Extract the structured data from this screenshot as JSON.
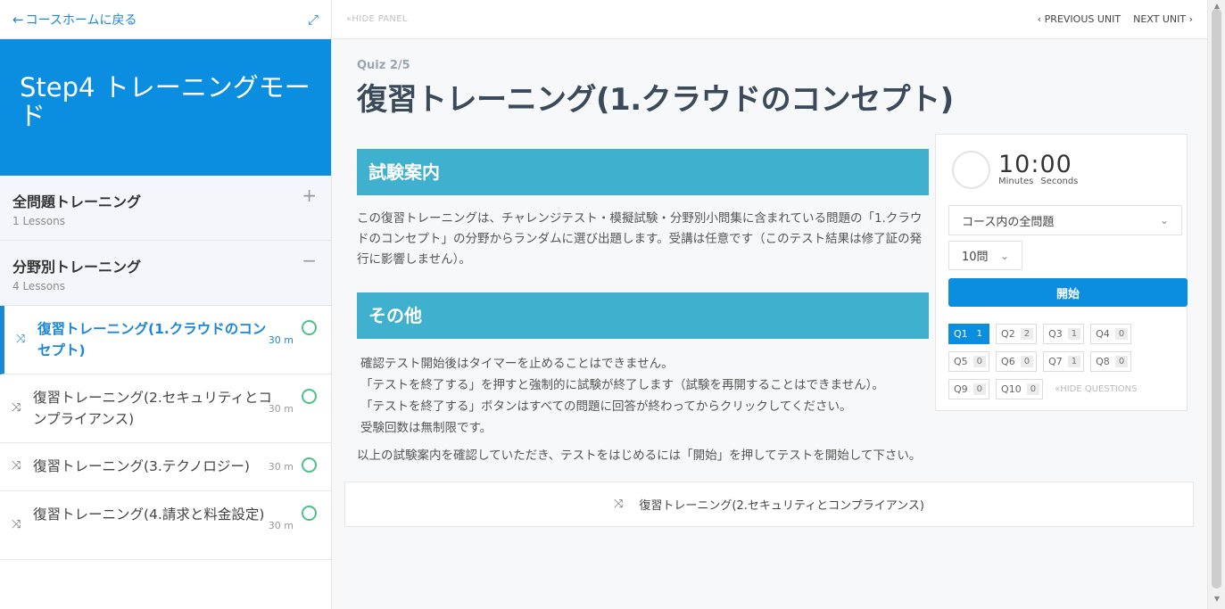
{
  "sidebar": {
    "back_label": "コースホームに戻る",
    "course_title": "Step4 トレーニングモード",
    "sections": [
      {
        "title": "全問題トレーニング",
        "sub": "1 Lessons",
        "toggle": "+"
      },
      {
        "title": "分野別トレーニング",
        "sub": "4 Lessons",
        "toggle": "−"
      }
    ],
    "lessons": [
      {
        "title": "復習トレーニング(1.クラウドのコンセプト)",
        "duration": "30 m"
      },
      {
        "title": "復習トレーニング(2.セキュリティとコンプライアンス)",
        "duration": "30 m"
      },
      {
        "title": "復習トレーニング(3.テクノロジー)",
        "duration": "30 m"
      },
      {
        "title": "復習トレーニング(4.請求と料金設定)",
        "duration": "30 m"
      }
    ]
  },
  "topbar": {
    "hide_panel": "HIDE PANEL",
    "prev_unit": "PREVIOUS UNIT",
    "next_unit": "NEXT UNIT"
  },
  "main": {
    "quiz_label": "Quiz 2/5",
    "title": "復習トレーニング(1.クラウドのコンセプト)",
    "section1_title": "試験案内",
    "section1_text": "この復習トレーニングは、チャレンジテスト・模擬試験・分野別小問集に含まれている問題の「1.クラウドのコンセプト」の分野からランダムに選び出題します。受講は任意です（このテスト結果は修了証の発行に影響しません）。",
    "section2_title": "その他",
    "section2_lines": [
      "確認テスト開始後はタイマーを止めることはできません。",
      "「テストを終了する」を押すと強制的に試験が終了します（試験を再開することはできません）。",
      "「テストを終了する」ボタンはすべての問題に回答が終わってからクリックしてください。",
      "受験回数は無制限です。"
    ],
    "closing_text": "以上の試験案内を確認していただき、テストをはじめるには「開始」を押してテストを開始して下さい。",
    "next_lesson": "復習トレーニング(2.セキュリティとコンプライアンス)"
  },
  "timer": {
    "minutes": "10",
    "seconds": "00",
    "minutes_label": "Minutes",
    "seconds_label": "Seconds",
    "scope_select": "コース内の全問題",
    "count_select": "10問",
    "start_label": "開始",
    "hide_questions": "HIDE QUESTIONS",
    "questions": [
      {
        "label": "Q1",
        "count": "1"
      },
      {
        "label": "Q2",
        "count": "2"
      },
      {
        "label": "Q3",
        "count": "1"
      },
      {
        "label": "Q4",
        "count": "0"
      },
      {
        "label": "Q5",
        "count": "0"
      },
      {
        "label": "Q6",
        "count": "0"
      },
      {
        "label": "Q7",
        "count": "1"
      },
      {
        "label": "Q8",
        "count": "0"
      },
      {
        "label": "Q9",
        "count": "0"
      },
      {
        "label": "Q10",
        "count": "0"
      }
    ]
  },
  "colors": {
    "accent": "#0b8ee0",
    "section_header": "#3fb0cd",
    "complete_ring": "#4ec187"
  }
}
